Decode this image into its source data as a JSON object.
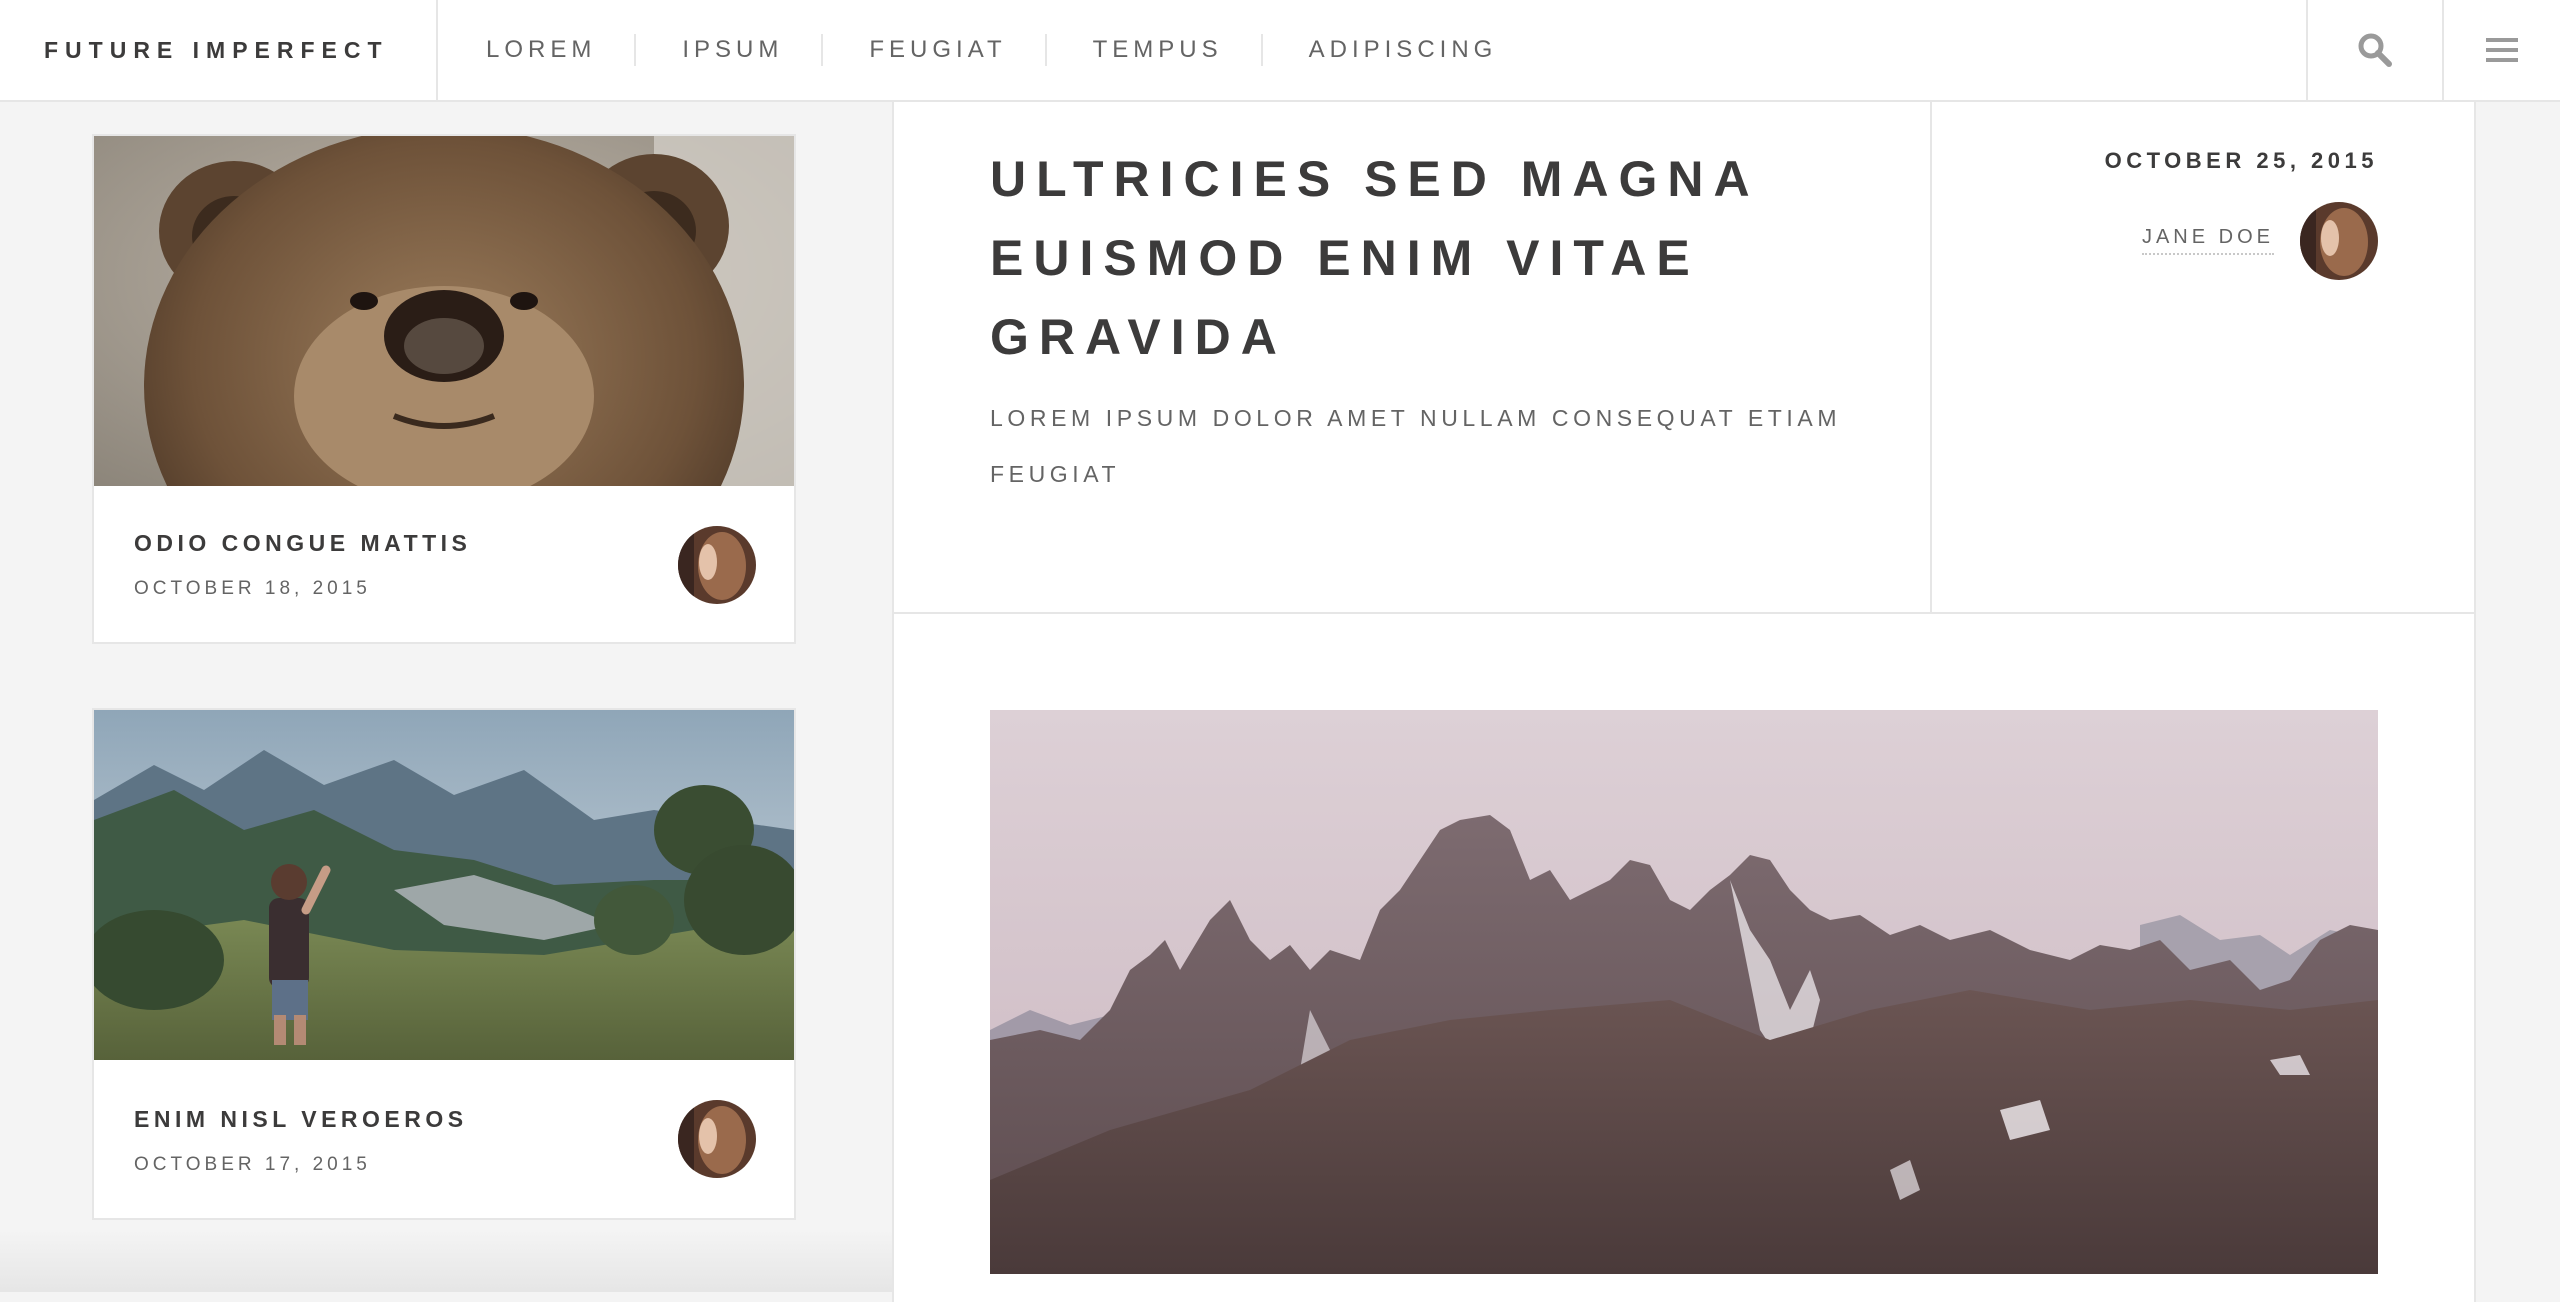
{
  "header": {
    "brand": "FUTURE IMPERFECT",
    "nav": [
      "LOREM",
      "IPSUM",
      "FEUGIAT",
      "TEMPUS",
      "ADIPISCING"
    ],
    "icons": [
      "search-icon",
      "hamburger-menu-icon"
    ]
  },
  "sidebar": {
    "posts": [
      {
        "title": "ODIO CONGUE MATTIS",
        "date": "OCTOBER 18, 2015",
        "image": "bear-photo"
      },
      {
        "title": "ENIM NISL VEROEROS",
        "date": "OCTOBER 17, 2015",
        "image": "mountain-hiker-photo"
      }
    ]
  },
  "post": {
    "title": "ULTRICIES SED MAGNA EUISMOD ENIM VITAE GRAVIDA",
    "subtitle": "LOREM IPSUM DOLOR AMET NULLAM CONSEQUAT ETIAM FEUGIAT",
    "date": "OCTOBER 25, 2015",
    "author": "JANE DOE",
    "image": "mountain-peaks-photo"
  },
  "colors": {
    "background": "#f4f4f4",
    "panel": "#ffffff",
    "border": "#e6e6e6",
    "heading": "#3c3b3b",
    "muted": "#646464"
  }
}
